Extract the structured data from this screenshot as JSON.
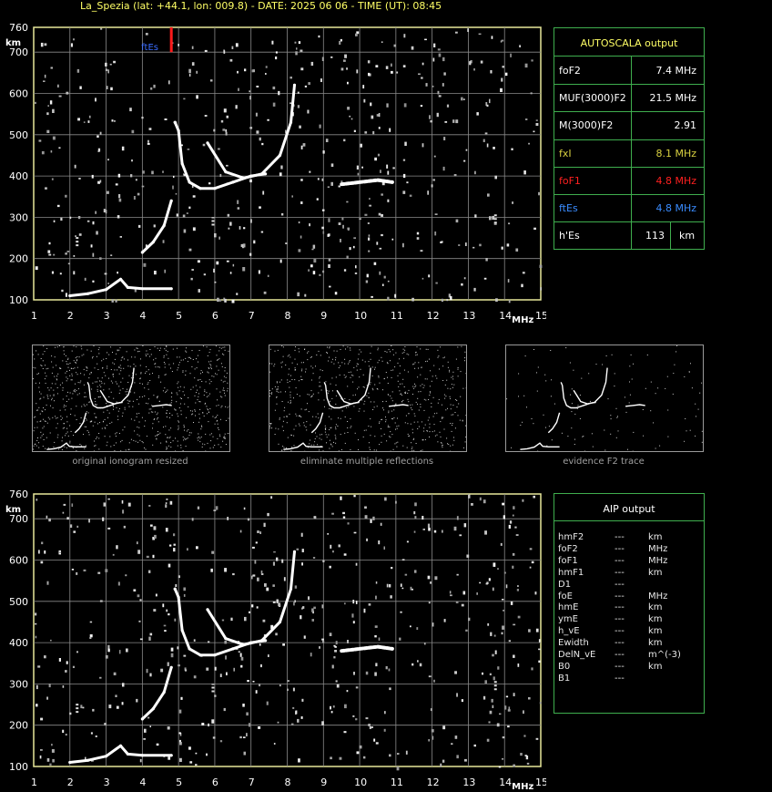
{
  "header": "La_Spezia (lat: +44.1, lon: 009.8) - DATE: 2025 06 06 - TIME (UT): 08:45",
  "ionogram_main": {
    "unit_y": "km",
    "unit_x": "MHz",
    "y_ticks": [
      "100",
      "200",
      "300",
      "400",
      "500",
      "600",
      "700",
      "760"
    ],
    "x_ticks": [
      "1",
      "2",
      "3",
      "4",
      "5",
      "6",
      "7",
      "8",
      "9",
      "10",
      "11",
      "12",
      "13",
      "14",
      "15"
    ],
    "marker_label": "ftEs"
  },
  "ionogram_aip": {
    "unit_y": "km",
    "unit_x": "MHz",
    "y_ticks": [
      "100",
      "200",
      "300",
      "400",
      "500",
      "600",
      "700",
      "760"
    ],
    "x_ticks": [
      "1",
      "2",
      "3",
      "4",
      "5",
      "6",
      "7",
      "8",
      "9",
      "10",
      "11",
      "12",
      "13",
      "14",
      "15"
    ]
  },
  "thumbnails": [
    {
      "caption": "original ionogram resized"
    },
    {
      "caption": "eliminate multiple reflections"
    },
    {
      "caption": "evidence F2 trace"
    }
  ],
  "autoscala": {
    "title": "AUTOSCALA output",
    "rows": [
      {
        "label": "foF2",
        "value": "7.4 MHz",
        "color": "#ffffff"
      },
      {
        "label": "MUF(3000)F2",
        "value": "21.5 MHz",
        "color": "#ffffff"
      },
      {
        "label": "M(3000)F2",
        "value": "2.91",
        "color": "#ffffff"
      },
      {
        "label": "fxI",
        "value": "8.1 MHz",
        "color": "#d8d040"
      },
      {
        "label": "foF1",
        "value": "4.8 MHz",
        "color": "#ff2020"
      },
      {
        "label": "ftEs",
        "value": "4.8 MHz",
        "color": "#3a8cff"
      },
      {
        "label": "h'Es",
        "value": "113",
        "unit": "km",
        "color": "#ffffff"
      }
    ]
  },
  "aip": {
    "title": "AIP output",
    "rows": [
      {
        "label": "hmF2",
        "value": "---",
        "unit": "km"
      },
      {
        "label": "foF2",
        "value": "---",
        "unit": "MHz"
      },
      {
        "label": "foF1",
        "value": "---",
        "unit": "MHz"
      },
      {
        "label": "hmF1",
        "value": "---",
        "unit": "km"
      },
      {
        "label": "D1",
        "value": "---",
        "unit": ""
      },
      {
        "label": "foE",
        "value": "---",
        "unit": "MHz"
      },
      {
        "label": "hmE",
        "value": "---",
        "unit": "km"
      },
      {
        "label": "ymE",
        "value": "---",
        "unit": "km"
      },
      {
        "label": "h_vE",
        "value": "---",
        "unit": "km"
      },
      {
        "label": "Ewidth",
        "value": "---",
        "unit": "km"
      },
      {
        "label": "DelN_vE",
        "value": "---",
        "unit": "m^(-3)"
      },
      {
        "label": "B0",
        "value": "---",
        "unit": "km"
      },
      {
        "label": "B1",
        "value": "---",
        "unit": ""
      }
    ]
  },
  "chart_data": [
    {
      "type": "scatter",
      "title": "",
      "xlabel": "MHz",
      "ylabel": "km",
      "xlim": [
        1,
        15
      ],
      "ylim": [
        100,
        760
      ],
      "grid": true,
      "series": [
        {
          "name": "",
          "x": [
            4.9,
            5.0,
            5.1,
            5.3,
            5.6,
            6.0,
            6.5,
            7.0,
            7.4
          ],
          "y": [
            530,
            510,
            430,
            385,
            370,
            370,
            385,
            400,
            405
          ]
        },
        {
          "name": "",
          "x": [
            5.8,
            6.3,
            6.8,
            7.3,
            7.8,
            8.1,
            8.2
          ],
          "y": [
            480,
            410,
            395,
            405,
            450,
            530,
            620
          ]
        },
        {
          "name": "",
          "x": [
            4.0,
            4.3,
            4.6,
            4.8
          ],
          "y": [
            215,
            240,
            280,
            340
          ]
        },
        {
          "name": "",
          "x": [
            2.0,
            2.5,
            3.0,
            3.4,
            3.6,
            4.0,
            4.8
          ],
          "y": [
            110,
            115,
            125,
            150,
            130,
            127,
            127
          ]
        },
        {
          "name": "",
          "x": [
            9.5,
            10.0,
            10.5,
            10.9
          ],
          "y": [
            380,
            385,
            390,
            385
          ]
        }
      ],
      "markers": [
        {
          "label": "ftEs",
          "x": 4.8
        }
      ]
    }
  ]
}
